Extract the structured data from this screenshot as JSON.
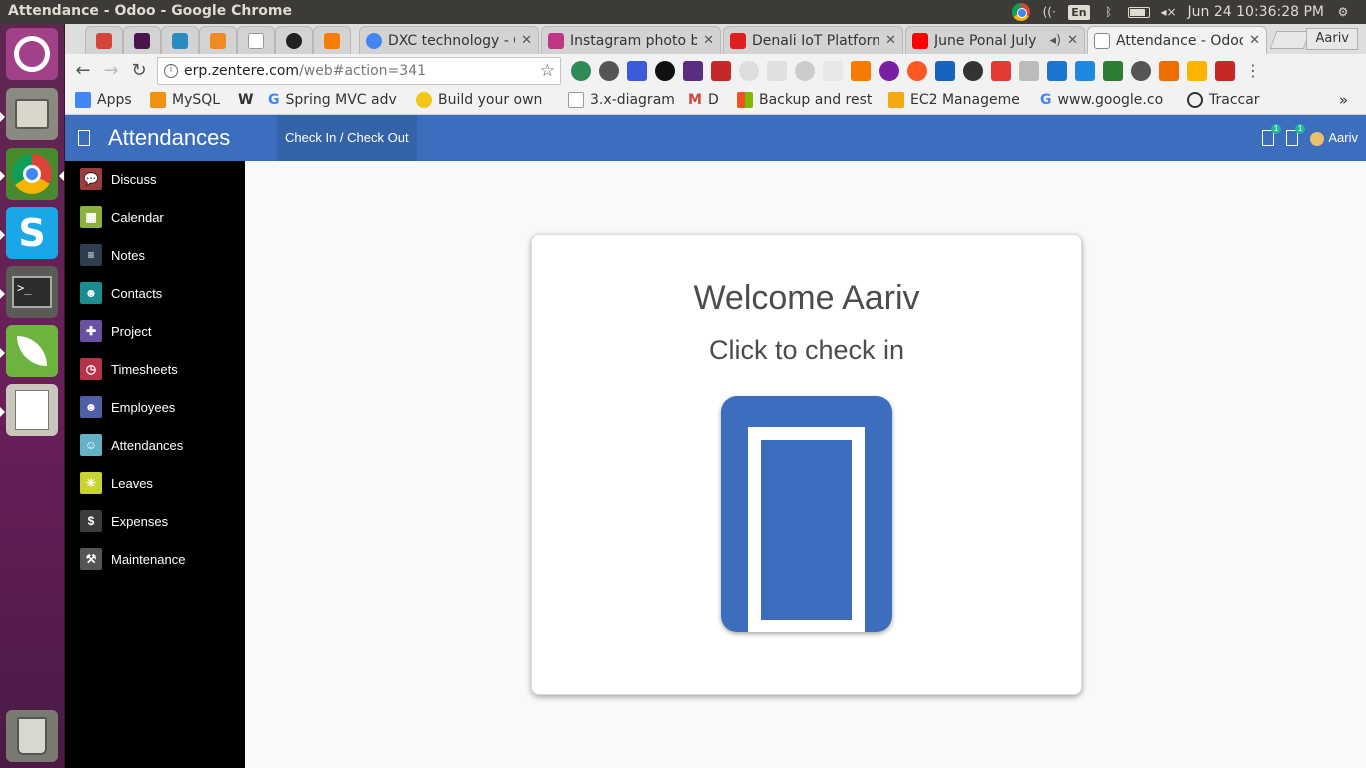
{
  "window": {
    "title": "Attendance - Odoo - Google Chrome"
  },
  "system_tray": {
    "lang": "En",
    "clock": "Jun 24 10:36:28 PM"
  },
  "tabs": [
    {
      "label": "",
      "color": "#d44638"
    },
    {
      "label": "",
      "color": "#4a154b"
    },
    {
      "label": "",
      "color": "#2b8cc4"
    },
    {
      "label": "",
      "color": "#f08a24"
    },
    {
      "label": "",
      "color": "#999999"
    },
    {
      "label": "",
      "color": "#222222"
    },
    {
      "label": "",
      "color": "#f57d00"
    },
    {
      "label": "DXC technology - G",
      "color": "#4285f4"
    },
    {
      "label": "Instagram photo b",
      "color": "#c13584"
    },
    {
      "label": "Denali IoT Platform",
      "color": "#e02020"
    },
    {
      "label": "June Ponal July",
      "color": "#ff0000"
    },
    {
      "label": "Attendance - Odoo",
      "color": "#888888"
    }
  ],
  "profile_name": "Aariv",
  "address_bar": {
    "host": "erp.zentere.com",
    "path": "/web#action=341"
  },
  "bookmarks": [
    {
      "label": "Apps",
      "color": "#4285f4"
    },
    {
      "label": "MySQL",
      "color": "#f29111"
    },
    {
      "label": "",
      "color": "#000000",
      "glyph": "W"
    },
    {
      "label": "Spring MVC adv",
      "color": "#4285f4",
      "glyph": "G"
    },
    {
      "label": "Build your own",
      "color": "#f5c518"
    },
    {
      "label": "3.x-diagram",
      "color": "#aaaaaa"
    },
    {
      "label": "D",
      "color": "#d44638",
      "glyph": "M"
    },
    {
      "label": "Backup and rest",
      "color": "#f25022"
    },
    {
      "label": "EC2 Manageme",
      "color": "#f7a80d"
    },
    {
      "label": "www.google.co",
      "color": "#4285f4",
      "glyph": "G"
    },
    {
      "label": "Traccar",
      "color": "#333333"
    }
  ],
  "odoo": {
    "app_title": "Attendances",
    "top_menu": "Check In / Check Out",
    "notif_count_1": "1",
    "notif_count_2": "1",
    "user": "Aariv",
    "sidebar": [
      {
        "label": "Discuss",
        "color": "#9b3d3d"
      },
      {
        "label": "Calendar",
        "color": "#8eb03f"
      },
      {
        "label": "Notes",
        "color": "#2e3e4e"
      },
      {
        "label": "Contacts",
        "color": "#1a8e8e"
      },
      {
        "label": "Project",
        "color": "#6b4fa0"
      },
      {
        "label": "Timesheets",
        "color": "#b8324a"
      },
      {
        "label": "Employees",
        "color": "#4e5fa8"
      },
      {
        "label": "Attendances",
        "color": "#63b2c8"
      },
      {
        "label": "Leaves",
        "color": "#c9d432"
      },
      {
        "label": "Expenses",
        "color": "#3c3c3c"
      },
      {
        "label": "Maintenance",
        "color": "#555555"
      }
    ],
    "welcome": "Welcome Aariv",
    "hint": "Click to check in"
  }
}
